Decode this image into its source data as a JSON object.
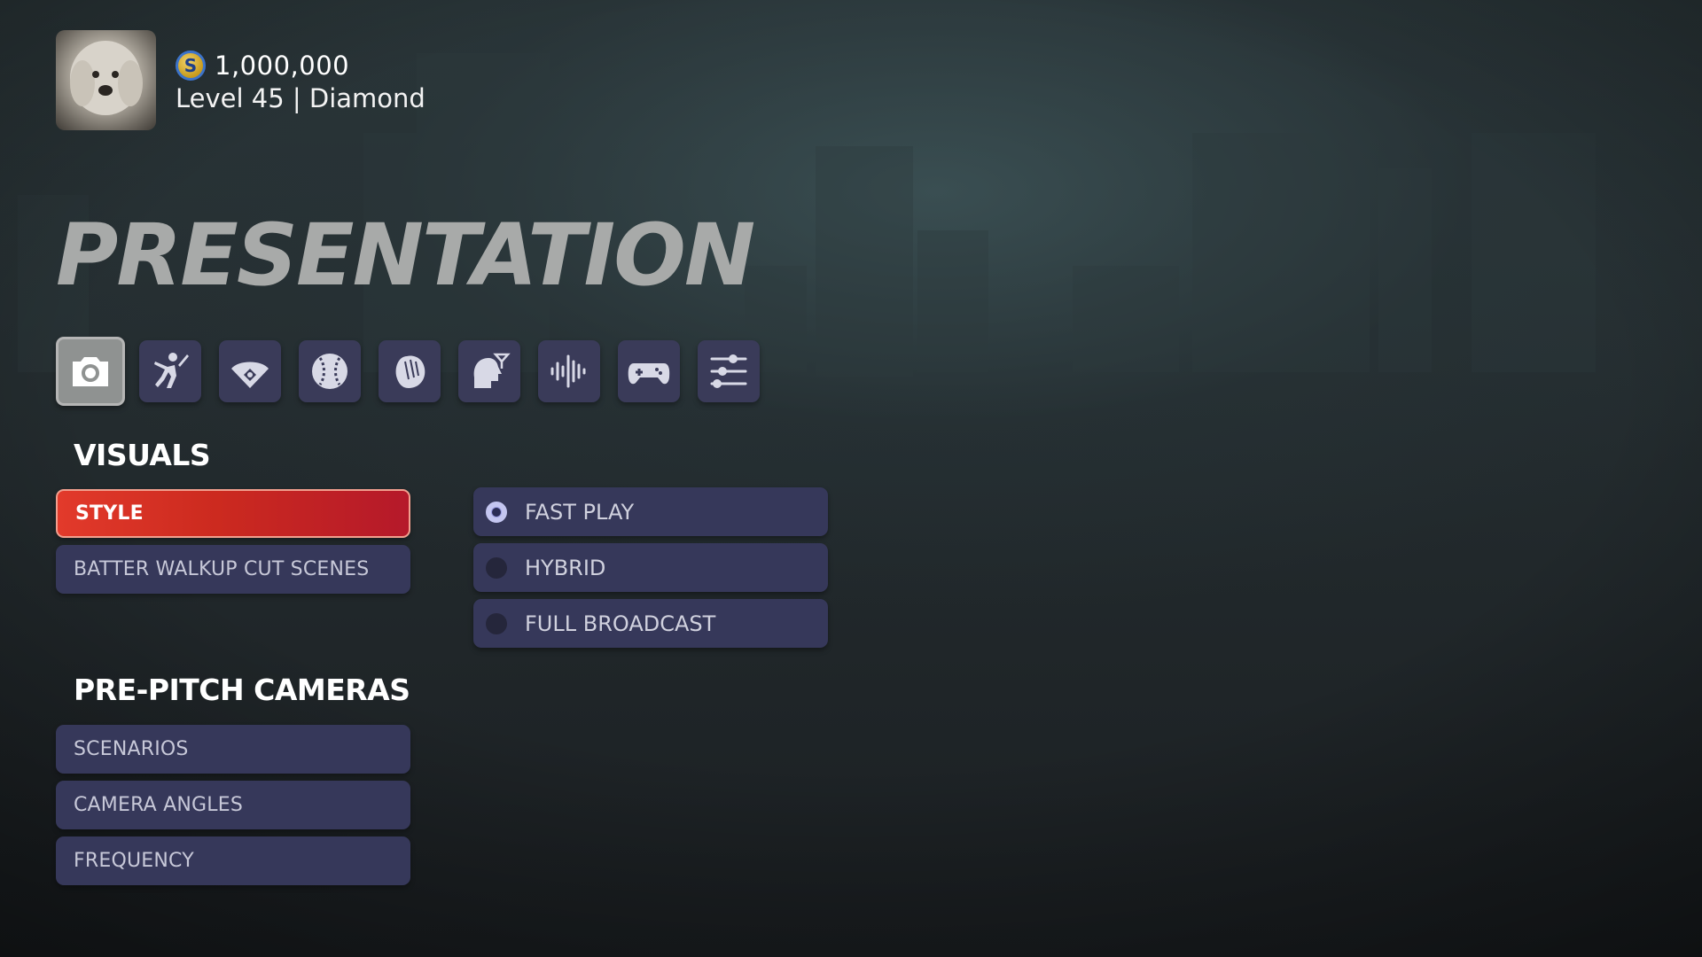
{
  "profile": {
    "currency_icon": "coin-icon",
    "currency_symbol": "S",
    "currency": "1,000,000",
    "level": "Level 45 | Diamond"
  },
  "page": {
    "title": "PRESENTATION"
  },
  "tabs": [
    {
      "icon": "camera-icon",
      "active": true
    },
    {
      "icon": "batter-icon",
      "active": false
    },
    {
      "icon": "field-icon",
      "active": false
    },
    {
      "icon": "baseball-icon",
      "active": false
    },
    {
      "icon": "glove-icon",
      "active": false
    },
    {
      "icon": "head-gear-icon",
      "active": false
    },
    {
      "icon": "audio-wave-icon",
      "active": false
    },
    {
      "icon": "gamepad-icon",
      "active": false
    },
    {
      "icon": "sliders-icon",
      "active": false
    }
  ],
  "visuals": {
    "heading": "VISUALS",
    "items": [
      "STYLE",
      "BATTER WALKUP CUT SCENES"
    ],
    "selected": "STYLE"
  },
  "style_options": {
    "items": [
      "FAST PLAY",
      "HYBRID",
      "FULL BROADCAST"
    ],
    "checked": "FAST PLAY"
  },
  "pre_pitch": {
    "heading": "PRE-PITCH CAMERAS",
    "items": [
      "SCENARIOS",
      "CAMERA ANGLES",
      "FREQUENCY"
    ]
  },
  "colors": {
    "selected_gradient_start": "#e23a2b",
    "selected_gradient_end": "#b5192a",
    "button_bg": "#36385a",
    "title": "#a8aaa9"
  }
}
